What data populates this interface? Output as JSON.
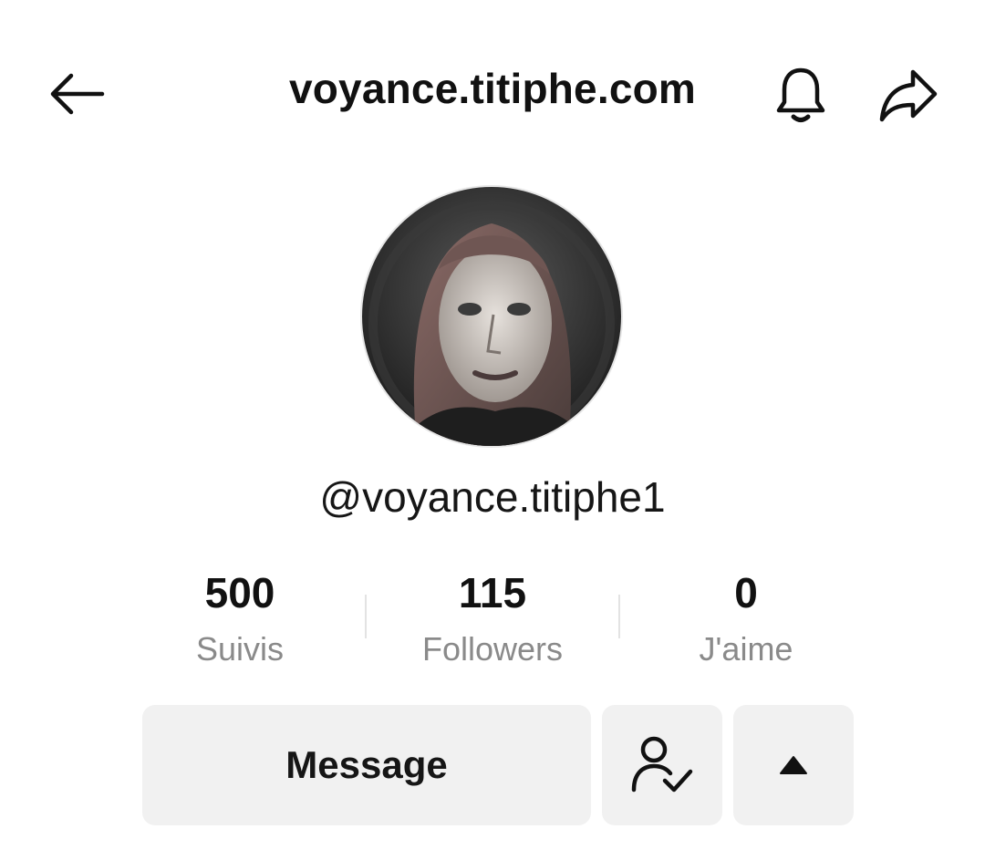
{
  "header": {
    "title": "voyance.titiphe.com",
    "back_icon": "back-arrow-icon",
    "bell_icon": "bell-icon",
    "share_icon": "share-icon"
  },
  "profile": {
    "username": "@voyance.titiphe1",
    "stats": [
      {
        "value": "500",
        "label": "Suivis"
      },
      {
        "value": "115",
        "label": "Followers"
      },
      {
        "value": "0",
        "label": "J'aime"
      }
    ]
  },
  "actions": {
    "message_label": "Message",
    "following_icon": "user-check-icon",
    "more_icon": "triangle-up-icon"
  },
  "colors": {
    "text": "#111111",
    "muted": "#8a8a8a",
    "button_bg": "#f1f1f1"
  }
}
